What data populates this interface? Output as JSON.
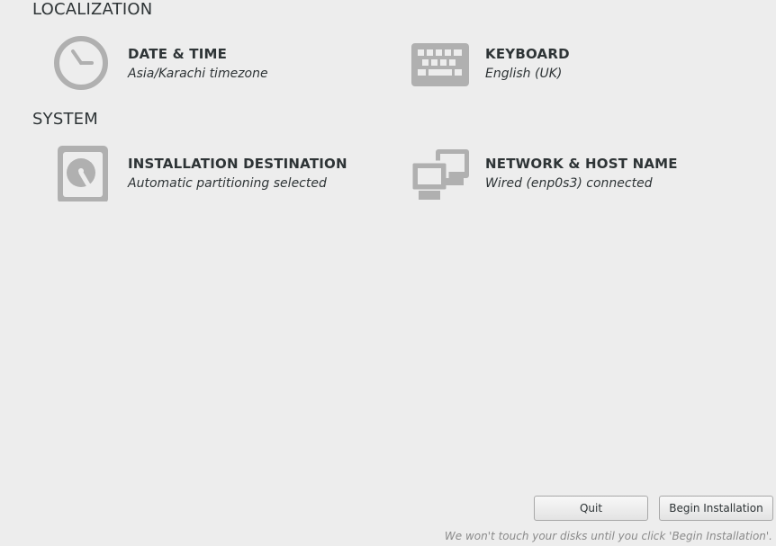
{
  "sections": {
    "localization": {
      "heading": "LOCALIZATION"
    },
    "system": {
      "heading": "SYSTEM"
    }
  },
  "spokes": {
    "datetime": {
      "title": "DATE & TIME",
      "status": "Asia/Karachi timezone",
      "icon": "clock-icon"
    },
    "keyboard": {
      "title": "KEYBOARD",
      "status": "English (UK)",
      "icon": "keyboard-icon"
    },
    "storage": {
      "title": "INSTALLATION DESTINATION",
      "status": "Automatic partitioning selected",
      "icon": "hard-disk-icon"
    },
    "network": {
      "title": "NETWORK & HOST NAME",
      "status": "Wired (enp0s3) connected",
      "icon": "network-computers-icon"
    }
  },
  "buttons": {
    "quit": "Quit",
    "begin": "Begin Installation"
  },
  "footnote": "We won't touch your disks until you click 'Begin Installation'.",
  "colors": {
    "background": "#ededed",
    "icon": "#b0b0b0",
    "text": "#2e3436",
    "footnote": "#8a8a8a"
  }
}
